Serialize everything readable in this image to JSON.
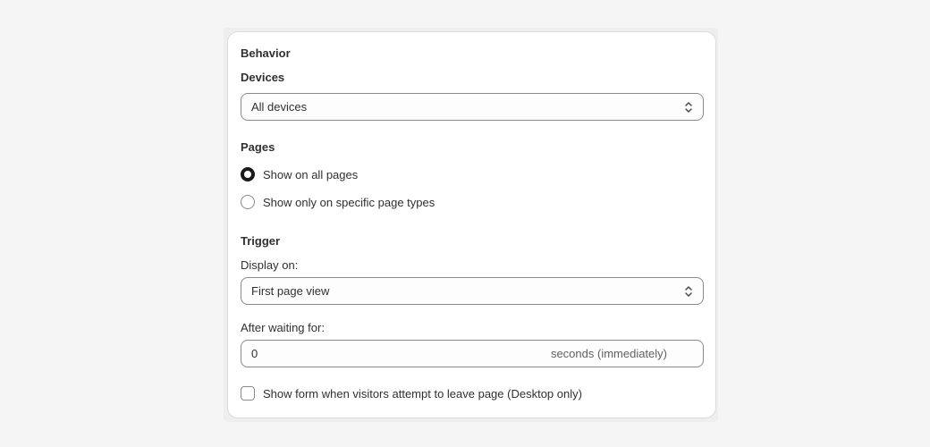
{
  "card": {
    "title": "Behavior"
  },
  "devices": {
    "heading": "Devices",
    "selected": "All devices"
  },
  "pages": {
    "heading": "Pages",
    "options": [
      {
        "label": "Show on all pages",
        "checked": true
      },
      {
        "label": "Show only on specific page types",
        "checked": false
      }
    ]
  },
  "trigger": {
    "heading": "Trigger",
    "display_on_label": "Display on:",
    "display_on_selected": "First page view",
    "after_waiting_label": "After waiting for:",
    "after_waiting_value": "0",
    "after_waiting_suffix": "seconds (immediately)"
  },
  "exit_intent": {
    "label": "Show form when visitors attempt to leave page (Desktop only)",
    "checked": false
  },
  "icons": {
    "select_chevron": "chevron-up-down-icon"
  }
}
